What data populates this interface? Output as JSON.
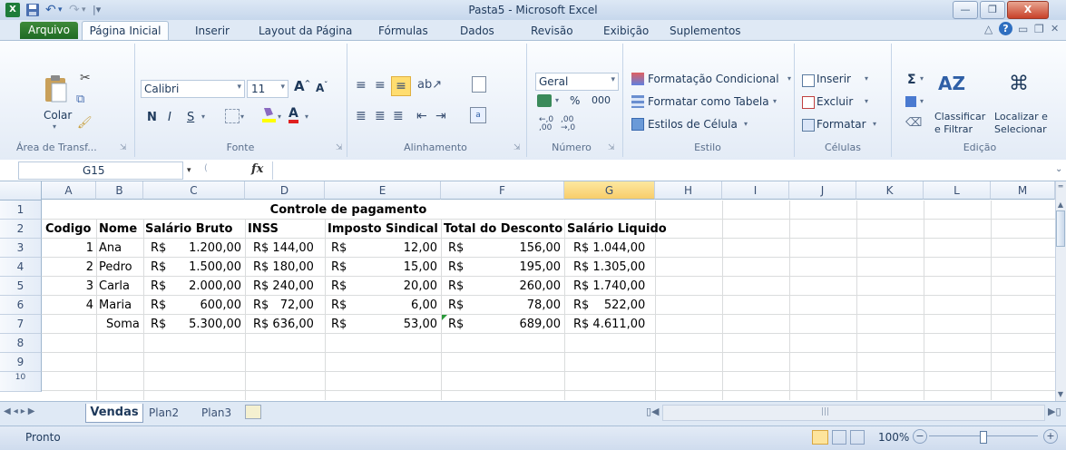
{
  "window": {
    "title": "Pasta5  -  Microsoft Excel",
    "minimize": "—",
    "restore": "❐",
    "close": "X"
  },
  "ribbon_tabs": [
    "Arquivo",
    "Página Inicial",
    "Inserir",
    "Layout da Página",
    "Fórmulas",
    "Dados",
    "Revisão",
    "Exibição",
    "Suplementos"
  ],
  "ribbon": {
    "clipboard": {
      "paste": "Colar",
      "label": "Área de Transf..."
    },
    "font": {
      "name": "Calibri",
      "size": "11",
      "bold": "N",
      "italic": "I",
      "underline": "S",
      "label": "Fonte"
    },
    "alignment": {
      "label": "Alinhamento"
    },
    "number": {
      "format": "Geral",
      "percent": "%",
      "thousands": "000",
      "label": "Número"
    },
    "styles": {
      "conditional": "Formatação Condicional",
      "as_table": "Formatar como Tabela",
      "cell_styles": "Estilos de Célula",
      "label": "Estilo"
    },
    "cells": {
      "insert": "Inserir",
      "delete": "Excluir",
      "format": "Formatar",
      "label": "Células"
    },
    "editing": {
      "sigma": "Σ",
      "sort1": "Classificar",
      "sort2": "e Filtrar",
      "find1": "Localizar e",
      "find2": "Selecionar",
      "label": "Edição"
    }
  },
  "formula_bar": {
    "name_box": "G15",
    "fx": "fx",
    "value": ""
  },
  "columns": [
    "A",
    "B",
    "C",
    "D",
    "E",
    "F",
    "G",
    "H",
    "I",
    "J",
    "K",
    "L",
    "M"
  ],
  "rows": [
    "1",
    "2",
    "3",
    "4",
    "5",
    "6",
    "7",
    "8",
    "9",
    "10"
  ],
  "sheet": {
    "title": "Controle de pagamento",
    "headers": [
      "Codigo",
      "Nome",
      "Salário Bruto",
      "INSS",
      "Imposto Sindical",
      "Total do Desconto",
      "Salário Liquido"
    ],
    "data": [
      {
        "codigo": "1",
        "nome": "Ana",
        "bruto_cur": "R$",
        "bruto": "1.200,00",
        "inss": "R$ 144,00",
        "imp_cur": "R$",
        "imp": "12,00",
        "desc_cur": "R$",
        "desc": "156,00",
        "liq": "R$ 1.044,00"
      },
      {
        "codigo": "2",
        "nome": "Pedro",
        "bruto_cur": "R$",
        "bruto": "1.500,00",
        "inss": "R$ 180,00",
        "imp_cur": "R$",
        "imp": "15,00",
        "desc_cur": "R$",
        "desc": "195,00",
        "liq": "R$ 1.305,00"
      },
      {
        "codigo": "3",
        "nome": "Carla",
        "bruto_cur": "R$",
        "bruto": "2.000,00",
        "inss": "R$ 240,00",
        "imp_cur": "R$",
        "imp": "20,00",
        "desc_cur": "R$",
        "desc": "260,00",
        "liq": "R$ 1.740,00"
      },
      {
        "codigo": "4",
        "nome": "Maria",
        "bruto_cur": "R$",
        "bruto": "600,00",
        "inss": "R$   72,00",
        "imp_cur": "R$",
        "imp": "6,00",
        "desc_cur": "R$",
        "desc": "78,00",
        "liq": "R$    522,00"
      }
    ],
    "total": {
      "nome": "Soma",
      "bruto_cur": "R$",
      "bruto": "5.300,00",
      "inss": "R$ 636,00",
      "imp_cur": "R$",
      "imp": "53,00",
      "desc_cur": "R$",
      "desc": "689,00",
      "liq": "R$ 4.611,00"
    }
  },
  "sheet_tabs": [
    "Vendas",
    "Plan2",
    "Plan3"
  ],
  "status": {
    "ready": "Pronto",
    "zoom": "100%"
  }
}
